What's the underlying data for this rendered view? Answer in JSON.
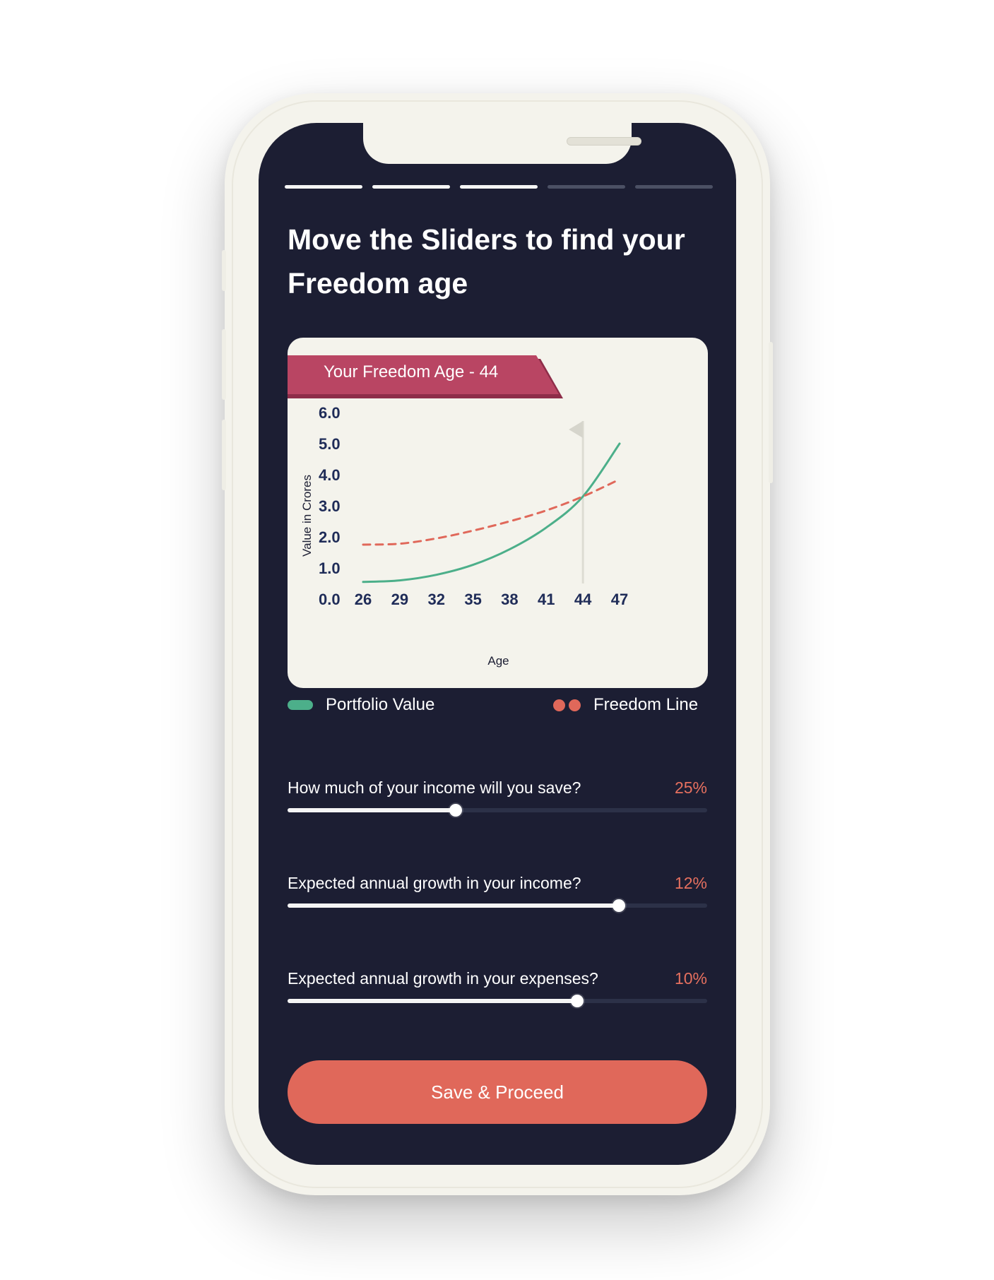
{
  "progress": {
    "total_steps": 5,
    "completed_steps": 3
  },
  "title": "Move the Sliders to find your Freedom age",
  "chart_card": {
    "badge_label": "Your Freedom Age - 44",
    "badge_color": "#b94563",
    "flag_icon": "flag-icon"
  },
  "chart_data": {
    "type": "line",
    "xlabel": "Age",
    "ylabel": "Value in Crores",
    "x_ticks": [
      "26",
      "29",
      "32",
      "35",
      "38",
      "41",
      "44",
      "47"
    ],
    "y_ticks": [
      "0.0",
      "1.0",
      "2.0",
      "3.0",
      "4.0",
      "5.0",
      "6.0"
    ],
    "ylim": [
      0,
      6
    ],
    "xlim": [
      26,
      47
    ],
    "marker_x": 44,
    "series": [
      {
        "name": "Portfolio Value",
        "color": "#4caf8a",
        "style": "solid",
        "x": [
          26,
          29,
          32,
          35,
          38,
          41,
          44,
          47
        ],
        "values": [
          0.55,
          0.6,
          0.78,
          1.1,
          1.6,
          2.3,
          3.3,
          5.0
        ]
      },
      {
        "name": "Freedom Line",
        "color": "#e0685a",
        "style": "dashed",
        "x": [
          26,
          29,
          32,
          35,
          38,
          41,
          44,
          47
        ],
        "values": [
          1.75,
          1.78,
          1.95,
          2.2,
          2.5,
          2.85,
          3.3,
          3.85
        ]
      }
    ]
  },
  "legend": {
    "portfolio_label": "Portfolio Value",
    "freedom_label": "Freedom Line"
  },
  "sliders": [
    {
      "label": "How much of your income will you save?",
      "value_text": "25%",
      "level": 0.4
    },
    {
      "label": "Expected annual growth in your income?",
      "value_text": "12%",
      "level": 0.79
    },
    {
      "label": "Expected annual growth in your expenses?",
      "value_text": "10%",
      "level": 0.69
    }
  ],
  "cta": {
    "label": "Save & Proceed",
    "color": "#e0685a"
  }
}
